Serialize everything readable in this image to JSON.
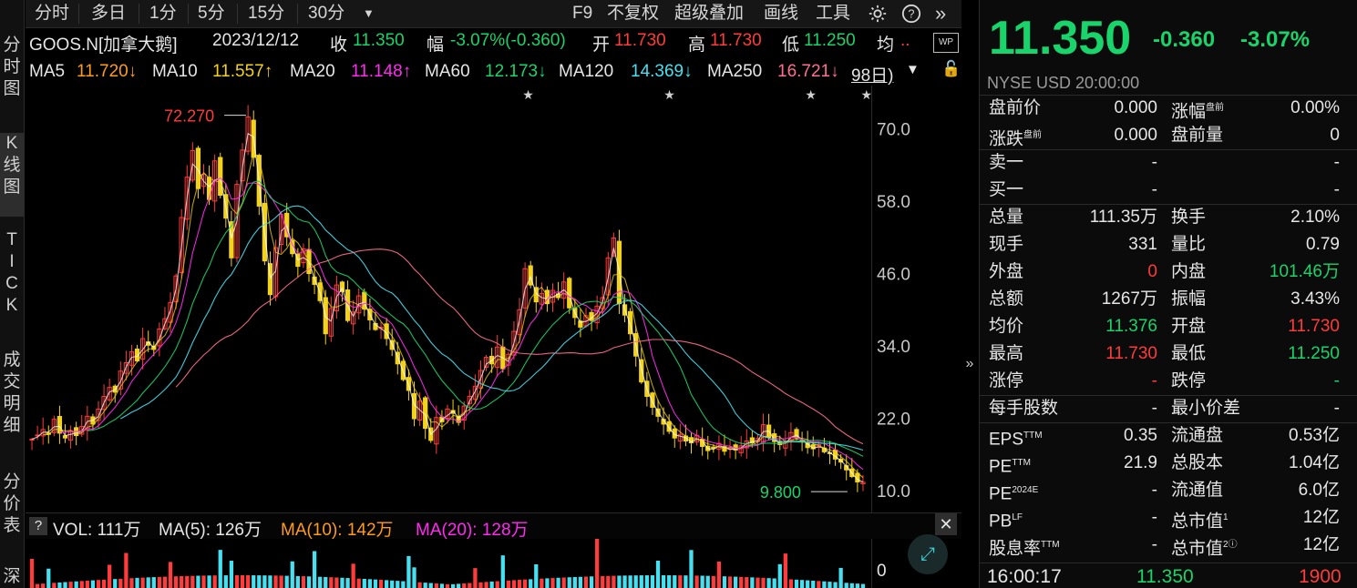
{
  "toolbar": {
    "items": [
      "分时",
      "多日",
      "1分",
      "5分",
      "15分",
      "30分"
    ],
    "dropdown_icon": "caret-down-icon",
    "right_items": [
      "F9",
      "不复权",
      "超级叠加",
      "画线",
      "工具"
    ],
    "icons": [
      "settings-icon",
      "help-icon",
      "double-chevron-right-icon"
    ]
  },
  "left_tabs": [
    "分\n时\n图",
    "K\n线\n图",
    "T\nI\nC\nK",
    "成\n交\n明\n细",
    "分\n价\n表",
    "深"
  ],
  "info": {
    "symbol": "GOOS.N[加拿大鹅]",
    "date": "2023/12/12",
    "close_label": "收",
    "close": "11.350",
    "change_label": "幅",
    "change": "-3.07%(-0.360)",
    "open_label": "开",
    "open": "11.730",
    "high_label": "高",
    "high": "11.730",
    "low_label": "低",
    "low": "11.250",
    "avg_label": "均",
    "avg_more": "..",
    "wp_badge": "WP"
  },
  "ma_row": {
    "ma5_label": "MA5",
    "ma5": "11.720↓",
    "ma10_label": "MA10",
    "ma10": "11.557↑",
    "ma20_label": "MA20",
    "ma20": "11.148↑",
    "ma60_label": "MA60",
    "ma60": "12.173↓",
    "ma120_label": "MA120",
    "ma120": "14.369↓",
    "ma250_label": "MA250",
    "ma250": "16.721↓",
    "extra": "98日)"
  },
  "chart_data": {
    "type": "candlestick",
    "y_ticks": [
      "70.0",
      "58.0",
      "46.0",
      "34.0",
      "22.0",
      "10.0"
    ],
    "ylim": [
      8,
      76
    ],
    "annotations": [
      {
        "text": "72.270",
        "value": 72.27
      },
      {
        "text": "9.800",
        "value": 9.8
      }
    ],
    "close_series": [
      18.5,
      19.2,
      20.1,
      19.3,
      21.8,
      19.5,
      18.7,
      19.9,
      19.1,
      20.6,
      22.3,
      21.0,
      23.5,
      25.6,
      27.1,
      26.3,
      29.8,
      31.2,
      33.0,
      31.5,
      35.2,
      34.1,
      33.4,
      36.8,
      38.5,
      41.2,
      45.6,
      55.3,
      62.0,
      66.4,
      60.1,
      62.5,
      58.3,
      64.7,
      59.0,
      55.2,
      48.6,
      60.8,
      66.5,
      72.0,
      65.3,
      57.2,
      48.1,
      42.5,
      50.3,
      55.8,
      52.1,
      49.3,
      47.2,
      50.1,
      46.0,
      44.2,
      41.5,
      36.0,
      40.2,
      44.1,
      43.0,
      38.2,
      39.6,
      42.3,
      40.1,
      38.3,
      36.7,
      37.1,
      35.2,
      33.4,
      31.0,
      28.4,
      26.6,
      21.9,
      24.8,
      20.3,
      18.3,
      22.1,
      21.4,
      23.5,
      22.8,
      21.3,
      24.0,
      25.6,
      27.3,
      29.9,
      32.1,
      31.0,
      33.8,
      30.2,
      32.6,
      36.4,
      40.0,
      46.8,
      44.1,
      41.3,
      42.7,
      41.0,
      43.2,
      42.0,
      44.6,
      40.3,
      38.7,
      37.1,
      39.0,
      38.2,
      40.6,
      42.0,
      48.6,
      51.9,
      41.0,
      39.1,
      36.0,
      32.3,
      28.0,
      25.6,
      23.8,
      22.3,
      21.0,
      19.8,
      18.7,
      19.3,
      18.2,
      17.9,
      19.1,
      17.3,
      16.6,
      17.0,
      17.8,
      16.5,
      17.1,
      16.7,
      17.4,
      18.2,
      17.9,
      18.6,
      20.9,
      18.8,
      18.1,
      17.6,
      18.0,
      19.6,
      18.7,
      18.3,
      17.1,
      16.9,
      17.6,
      16.4,
      16.1,
      15.2,
      14.7,
      13.4,
      12.3,
      11.4,
      11.35
    ],
    "series": [
      {
        "name": "MA5",
        "color": "#ffffff"
      },
      {
        "name": "MA10",
        "color": "#f2d21b"
      },
      {
        "name": "MA20",
        "color": "#ff2bf0"
      },
      {
        "name": "MA60",
        "color": "#19d36b"
      },
      {
        "name": "MA120",
        "color": "#46e0f0"
      },
      {
        "name": "MA250",
        "color": "#ff6f8f"
      }
    ],
    "star_markers": 4
  },
  "volume": {
    "help_label": "?",
    "vol_label": "VOL: 111万",
    "ma5": "MA(5): 126万",
    "ma10": "MA(10): 142万",
    "ma20": "MA(20): 128万",
    "zero_tick": "0",
    "close_icon": "close-icon",
    "expand_icon": "expand-arrows-icon"
  },
  "right": {
    "price": "11.350",
    "change": "-0.360",
    "change_pct": "-3.07%",
    "market": "NYSE  USD  20:00:00",
    "rows": [
      {
        "l1": "盘前价",
        "v1": "0.000",
        "l2": "涨幅",
        "sup2": "盘前",
        "v2": "0.00%",
        "c1": "white",
        "c2": "white"
      },
      {
        "l1": "涨跌",
        "sup1": "盘前",
        "v1": "0.000",
        "l2": "盘前量",
        "v2": "0",
        "c1": "white",
        "c2": "white"
      },
      {
        "l1": "卖一",
        "v1": "-",
        "l2": "",
        "v2": "-",
        "c1": "white",
        "c2": "white"
      },
      {
        "l1": "买一",
        "v1": "-",
        "l2": "",
        "v2": "-",
        "c1": "white",
        "c2": "white"
      },
      {
        "l1": "总量",
        "v1": "111.35万",
        "l2": "换手",
        "v2": "2.10%",
        "c1": "white",
        "c2": "white"
      },
      {
        "l1": "现手",
        "v1": "331",
        "l2": "量比",
        "v2": "0.79",
        "c1": "white",
        "c2": "white"
      },
      {
        "l1": "外盘",
        "v1": "0",
        "l2": "内盘",
        "v2": "101.46万",
        "c1": "red",
        "c2": "green"
      },
      {
        "l1": "总额",
        "v1": "1267万",
        "l2": "振幅",
        "v2": "3.43%",
        "c1": "white",
        "c2": "white"
      },
      {
        "l1": "均价",
        "v1": "11.376",
        "l2": "开盘",
        "v2": "11.730",
        "c1": "green",
        "c2": "red"
      },
      {
        "l1": "最高",
        "v1": "11.730",
        "l2": "最低",
        "v2": "11.250",
        "c1": "red",
        "c2": "green"
      },
      {
        "l1": "涨停",
        "v1": "-",
        "l2": "跌停",
        "v2": "-",
        "c1": "red",
        "c2": "green"
      },
      {
        "l1": "每手股数",
        "v1": "-",
        "l2": "最小价差",
        "v2": "-",
        "c1": "white",
        "c2": "white"
      },
      {
        "l1": "EPS",
        "sup1": "TTM",
        "v1": "0.35",
        "l2": "流通盘",
        "v2": "0.53亿",
        "c1": "white",
        "c2": "white"
      },
      {
        "l1": "PE",
        "sup1": "TTM",
        "v1": "21.9",
        "l2": "总股本",
        "v2": "1.04亿",
        "c1": "white",
        "c2": "white"
      },
      {
        "l1": "PE",
        "sup1": "2024E",
        "v1": "-",
        "l2": "流通值",
        "v2": "6.0亿",
        "c1": "white",
        "c2": "white"
      },
      {
        "l1": "PB",
        "sup1": "LF",
        "v1": "-",
        "l2": "总市值",
        "sup2": "1",
        "v2": "12亿",
        "c1": "white",
        "c2": "white"
      },
      {
        "l1": "股息率",
        "sup1": "TTM",
        "v1": "-",
        "l2": "总市值",
        "sup2": "2ⓘ",
        "v2": "12亿",
        "c1": "white",
        "c2": "white"
      }
    ],
    "tick": {
      "time": "16:00:17",
      "price": "11.350",
      "volume": "1900"
    },
    "collapse_icon": "collapse-arrow-icon"
  }
}
